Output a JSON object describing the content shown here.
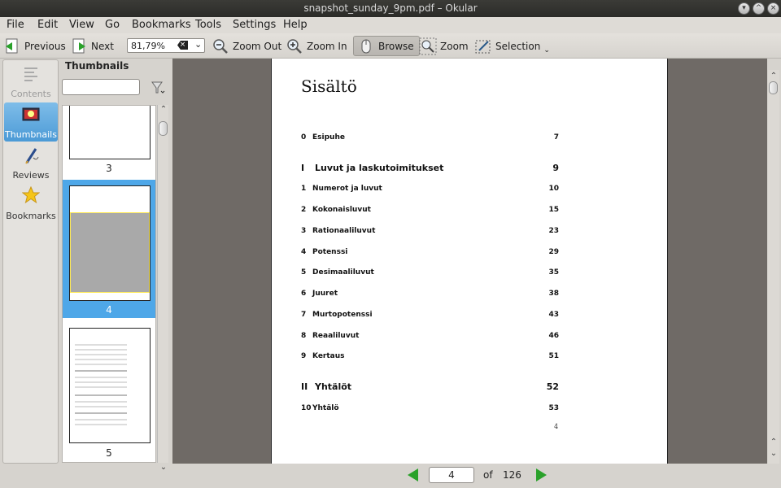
{
  "window": {
    "title": "snapshot_sunday_9pm.pdf – Okular"
  },
  "menu": [
    "File",
    "Edit",
    "View",
    "Go",
    "Bookmarks",
    "Tools",
    "Settings",
    "Help"
  ],
  "toolbar": {
    "previous": "Previous",
    "next": "Next",
    "zoom_value": "81,79%",
    "zoom_out": "Zoom Out",
    "zoom_in": "Zoom In",
    "browse": "Browse",
    "zoom": "Zoom",
    "selection": "Selection"
  },
  "sidebar": {
    "tabs": [
      {
        "label": "Contents",
        "icon": "contents-icon",
        "enabled": false
      },
      {
        "label": "Thumbnails",
        "icon": "thumbnails-icon",
        "active": true
      },
      {
        "label": "Reviews",
        "icon": "reviews-pen-icon"
      },
      {
        "label": "Bookmarks",
        "icon": "star-icon"
      }
    ]
  },
  "thumbnails": {
    "title": "Thumbnails",
    "search_placeholder": "",
    "items": [
      {
        "number": "3"
      },
      {
        "number": "4",
        "selected": true
      },
      {
        "number": "5"
      }
    ]
  },
  "document": {
    "heading": "Sisältö",
    "toc": [
      {
        "num": "0",
        "title": "Esipuhe",
        "page": "7"
      },
      {
        "num": "I",
        "title": "Luvut ja laskutoimitukset",
        "page": "9",
        "part": true
      },
      {
        "num": "1",
        "title": "Numerot ja luvut",
        "page": "10"
      },
      {
        "num": "2",
        "title": "Kokonaisluvut",
        "page": "15"
      },
      {
        "num": "3",
        "title": "Rationaaliluvut",
        "page": "23"
      },
      {
        "num": "4",
        "title": "Potenssi",
        "page": "29"
      },
      {
        "num": "5",
        "title": "Desimaaliluvut",
        "page": "35"
      },
      {
        "num": "6",
        "title": "Juuret",
        "page": "38"
      },
      {
        "num": "7",
        "title": "Murtopotenssi",
        "page": "43"
      },
      {
        "num": "8",
        "title": "Reaaliluvut",
        "page": "46"
      },
      {
        "num": "9",
        "title": "Kertaus",
        "page": "51"
      },
      {
        "num": "II",
        "title": "Yhtälöt",
        "page": "52",
        "part": true
      },
      {
        "num": "10",
        "title": "Yhtälö",
        "page": "53"
      }
    ],
    "footer_page": "4"
  },
  "pager": {
    "current": "4",
    "of_label": "of",
    "total": "126"
  },
  "colors": {
    "accent": "#4ea7e8",
    "nav_green": "#2aa12a",
    "doc_bg": "#6f6a66"
  }
}
